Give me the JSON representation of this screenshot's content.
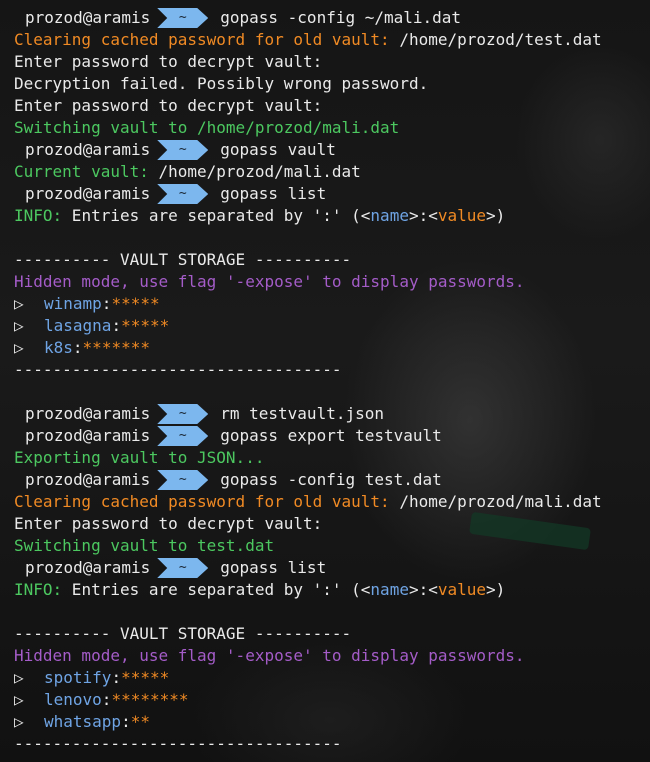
{
  "prompt": {
    "user": "prozod@aramis",
    "dir": "~"
  },
  "commands": {
    "c1": "gopass -config ~/mali.dat",
    "c2": "gopass vault",
    "c3": "gopass list",
    "c4": "rm testvault.json",
    "c5": "gopass export testvault",
    "c6": "gopass -config test.dat",
    "c7": "gopass list"
  },
  "msgs": {
    "clearing_label": "Clearing cached password for old vault:",
    "clearing_path1": " /home/prozod/test.dat",
    "clearing_path2": " /home/prozod/mali.dat",
    "enter_pw": "Enter password to decrypt vault:",
    "decrypt_failed": "Decryption failed. Possibly wrong password.",
    "switching1": "Switching vault to /home/prozod/mali.dat",
    "switching2": "Switching vault to test.dat",
    "current_label": "Current vault:",
    "current_path": " /home/prozod/mali.dat",
    "info_label": "INFO:",
    "info_text_a": " Entries are separated by ':' (<",
    "info_name": "name",
    "info_text_b": ">:<",
    "info_value": "value",
    "info_text_c": ">)",
    "storage_header": "---------- VAULT STORAGE ----------",
    "hidden_mode": "Hidden mode, use flag '-expose' to display passwords.",
    "separator": "----------------------------------",
    "exporting": "Exporting vault to JSON..."
  },
  "vault1": [
    {
      "name": "winamp",
      "mask": "*****"
    },
    {
      "name": "lasagna",
      "mask": "*****"
    },
    {
      "name": "k8s",
      "mask": "*******"
    }
  ],
  "vault2": [
    {
      "name": "spotify",
      "mask": "*****"
    },
    {
      "name": "lenovo",
      "mask": "********"
    },
    {
      "name": "whatsapp",
      "mask": "**"
    }
  ],
  "symbols": {
    "triangle": "▷",
    "colon": ":"
  },
  "colors": {
    "orange": "#f08a24",
    "green": "#4cc860",
    "purple": "#a45cc8",
    "blue": "#6fa4e4",
    "segment": "#7cb7ee"
  }
}
